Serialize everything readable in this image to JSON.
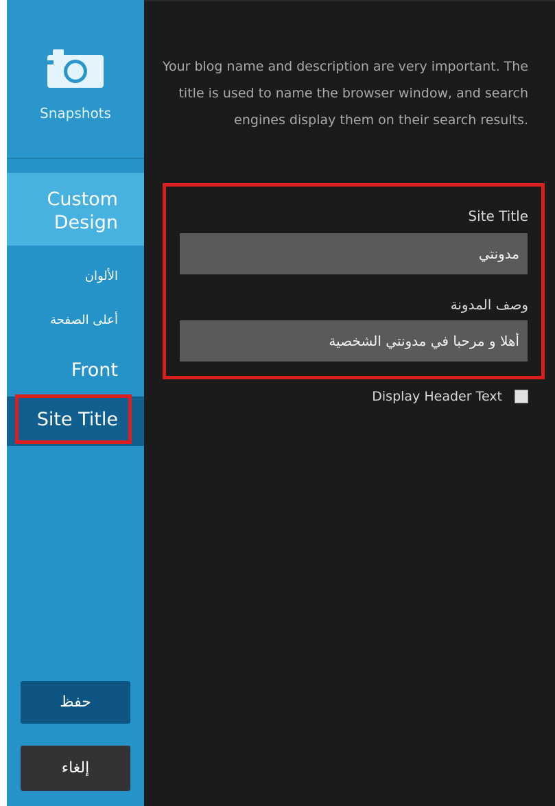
{
  "sidebar": {
    "snapshots_label": "Snapshots",
    "items": [
      {
        "label": "Custom Design"
      },
      {
        "label": "الألوان"
      },
      {
        "label": "أعلى الصفحة"
      },
      {
        "label": "Front"
      },
      {
        "label": "Site Title"
      }
    ],
    "save_label": "حفظ",
    "cancel_label": "إلغاء"
  },
  "main": {
    "description": "Your blog name and description are very important. The title is used to name the browser window, and search engines display them on their search results.",
    "site_title_label": "Site Title",
    "site_title_value": "مدونتي",
    "blog_desc_label": "وصف المدونة",
    "blog_desc_value": "أهلا و مرحبا في مدونتي الشخصية",
    "display_header_text_label": "Display Header Text"
  },
  "colors": {
    "sidebar_bg": "#2592c8",
    "active_item_bg": "#115f8e",
    "custom_design_bg": "#47b1df",
    "main_bg": "#1b1b1b",
    "highlight": "#d9201e"
  }
}
